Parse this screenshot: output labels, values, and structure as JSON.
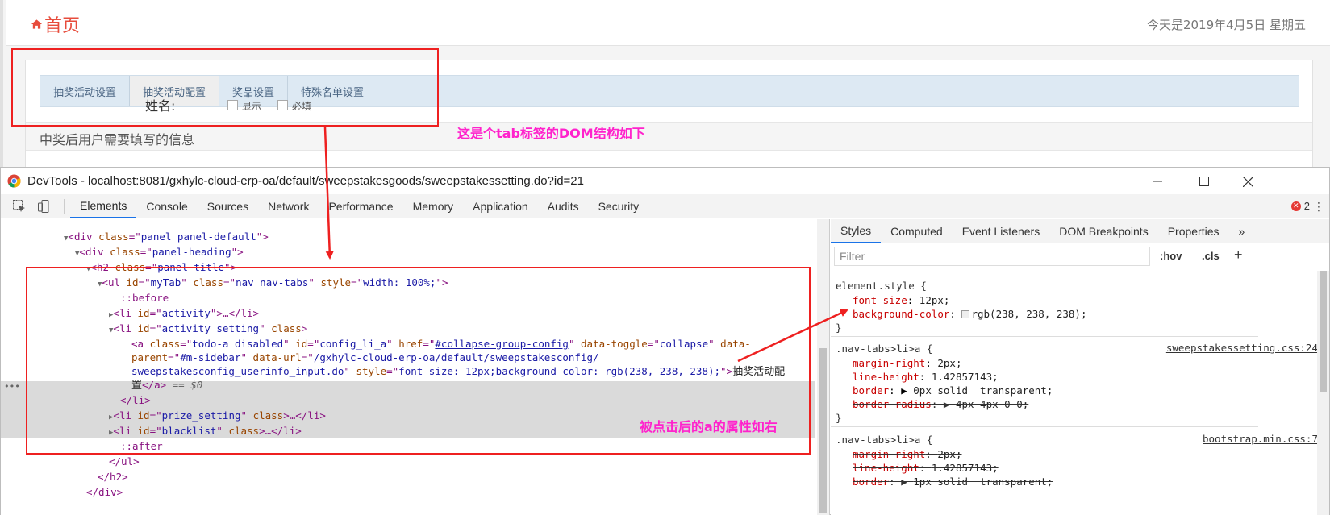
{
  "page": {
    "home_label": "首页",
    "date_text": "今天是2019年4月5日 星期五",
    "tabs": [
      {
        "label": "抽奖活动设置"
      },
      {
        "label": "抽奖活动配置"
      },
      {
        "label": "奖品设置"
      },
      {
        "label": "特殊名单设置"
      }
    ],
    "panel_subtitle": "中奖后用户需要填写的信息",
    "field_label": "姓名:",
    "checkbox_texts": [
      "显示",
      "必填"
    ]
  },
  "annotations": {
    "tab_dom_note": "这是个tab标签的DOM结构如下",
    "clicked_a_note": "被点击后的a的属性如右"
  },
  "devtools": {
    "title": "DevTools - localhost:8081/gxhylc-cloud-erp-oa/default/sweepstakesgoods/sweepstakessetting.do?id=21",
    "tabs": [
      "Elements",
      "Console",
      "Sources",
      "Network",
      "Performance",
      "Memory",
      "Application",
      "Audits",
      "Security"
    ],
    "error_count": "2",
    "styles_tabs": [
      "Styles",
      "Computed",
      "Event Listeners",
      "DOM Breakpoints",
      "Properties",
      "»"
    ],
    "filter_placeholder": "Filter",
    "hov_label": ":hov",
    "cls_label": ".cls",
    "dom_equals": "== $0",
    "link_text_1": "抽奖活动配",
    "link_text_2": "置",
    "css_rules": {
      "element_selector": "element.style {",
      "element_props": [
        {
          "name": "font-size",
          "value": "12px;"
        },
        {
          "name": "background-color",
          "value": "rgb(238, 238, 238);"
        }
      ],
      "rule1_selector": ".nav-tabs>li>a {",
      "rule1_source": "sweepstakessetting.css:24",
      "rule1_props": [
        {
          "name": "margin-right",
          "value": "2px;"
        },
        {
          "name": "line-height",
          "value": "1.42857143;"
        },
        {
          "name": "border",
          "value": "0px solid  transparent;"
        },
        {
          "name": "border-radius",
          "value": "4px 4px 0 0;"
        }
      ],
      "rule2_selector": ".nav-tabs>li>a {",
      "rule2_source": "bootstrap.min.css:7",
      "rule2_props": [
        {
          "name": "margin-right",
          "value": "2px;"
        },
        {
          "name": "line-height",
          "value": "1.42857143;"
        },
        {
          "name": "border",
          "value": "1px solid  transparent;"
        }
      ],
      "closing": "}"
    }
  }
}
